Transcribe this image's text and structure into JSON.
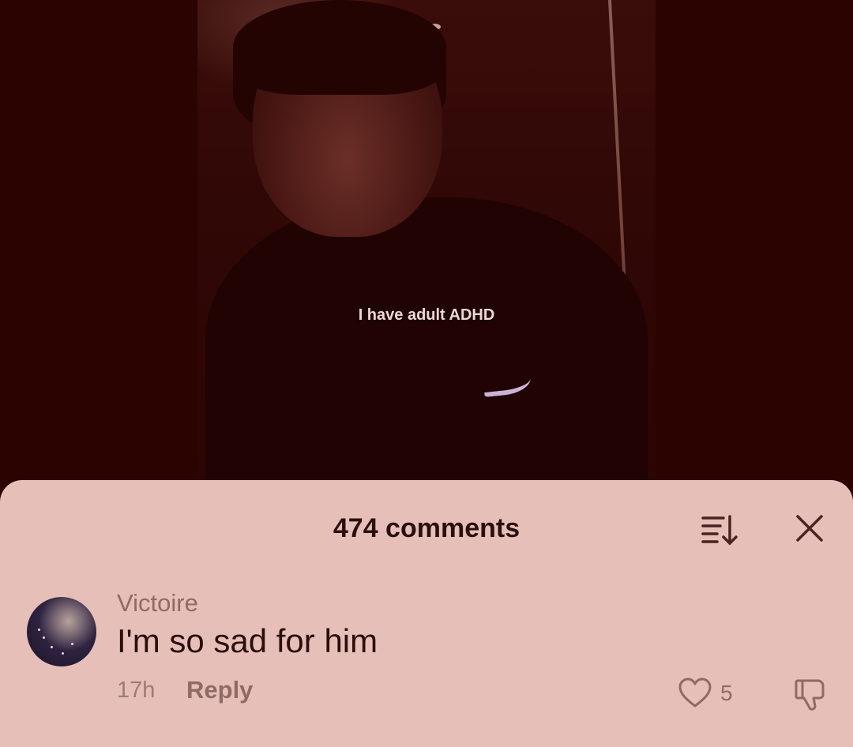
{
  "video": {
    "caption": "I have adult ADHD"
  },
  "comments_sheet": {
    "title": "474 comments",
    "icons": {
      "sort": "sort-icon",
      "close": "close-icon"
    },
    "comment": {
      "author": "Victoire",
      "text": "I'm so sad for him",
      "time": "17h",
      "reply_label": "Reply",
      "like_count": "5",
      "icons": {
        "avatar": "avatar",
        "like": "heart-icon",
        "dislike": "thumbs-down-icon"
      }
    }
  },
  "colors": {
    "overlay": "#2b0301",
    "sheet_bg": "#e6bfb8",
    "text_primary": "#2a0f0c",
    "text_secondary": "#8f6b66"
  }
}
